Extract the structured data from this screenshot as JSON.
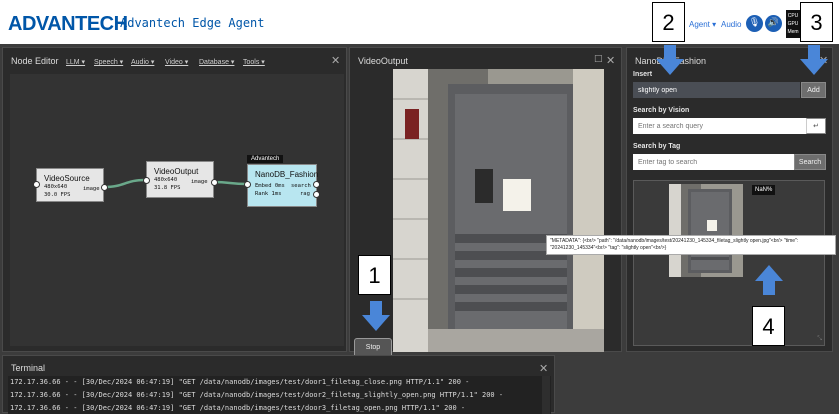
{
  "header": {
    "logo_text": "ADVANTECH",
    "title": "Advantech Edge Agent",
    "agent_menu": "Agent ▾",
    "audio_label": "Audio",
    "stats": [
      "CPU",
      "GPU",
      "Mem"
    ]
  },
  "node_editor": {
    "title": "Node Editor",
    "menus": [
      "LLM ▾",
      "Speech ▾",
      "Audio ▾",
      "Video ▾",
      "Database ▾",
      "Tools ▾"
    ],
    "nodes": {
      "video_source": {
        "title": "VideoSource",
        "lines": [
          "480x640",
          "30.0 FPS"
        ],
        "output": "image"
      },
      "video_output": {
        "title": "VideoOutput",
        "lines": [
          "480x640",
          "31.8 FPS"
        ],
        "output": "image"
      },
      "nanodb": {
        "tag": "Advantech",
        "title": "NanoDB_Fashion",
        "lines": [
          "Embed 0ms",
          "Rank 1ms"
        ],
        "outputs": [
          "search",
          "rag"
        ]
      }
    }
  },
  "video_output": {
    "title": "VideoOutput",
    "stop_label": "Stop"
  },
  "nanodb_panel": {
    "title": "NanoDB_Fashion",
    "insert_label": "Insert",
    "insert_value": "slightly open",
    "add_label": "Add",
    "search_vision_label": "Search by Vision",
    "search_vision_placeholder": "Enter a search query",
    "search_tag_label": "Search by Tag",
    "search_tag_placeholder": "Enter tag to search",
    "search_button": "Search",
    "result_badge": "NaN%",
    "tooltip": "\"METADATA\": {<br/> \"path\": \"/data/nanodb/images/test/20241230_145334_filetag_slightly open.jpg\"<br/> \"time\": \"20241230_145334\"<br/> \"tag\": \"slightly open\"<br/>}"
  },
  "terminal": {
    "title": "Terminal",
    "lines": [
      "172.17.36.66 - - [30/Dec/2024 06:47:19] \"GET /data/nanodb/images/test/door1_filetag_close.png HTTP/1.1\" 200 -",
      "172.17.36.66 - - [30/Dec/2024 06:47:19] \"GET /data/nanodb/images/test/door2_filetag_slightly_open.png HTTP/1.1\" 200 -",
      "172.17.36.66 - - [30/Dec/2024 06:47:19] \"GET /data/nanodb/images/test/door3_filetag_open.png HTTP/1.1\" 200 -"
    ]
  },
  "annotations": [
    "1",
    "2",
    "3",
    "4"
  ],
  "colors": {
    "brand": "#0056a8",
    "arrow": "#4a86d8",
    "node_fill": "#e6e6e6",
    "nanodb_fill": "#b8e6f0"
  }
}
